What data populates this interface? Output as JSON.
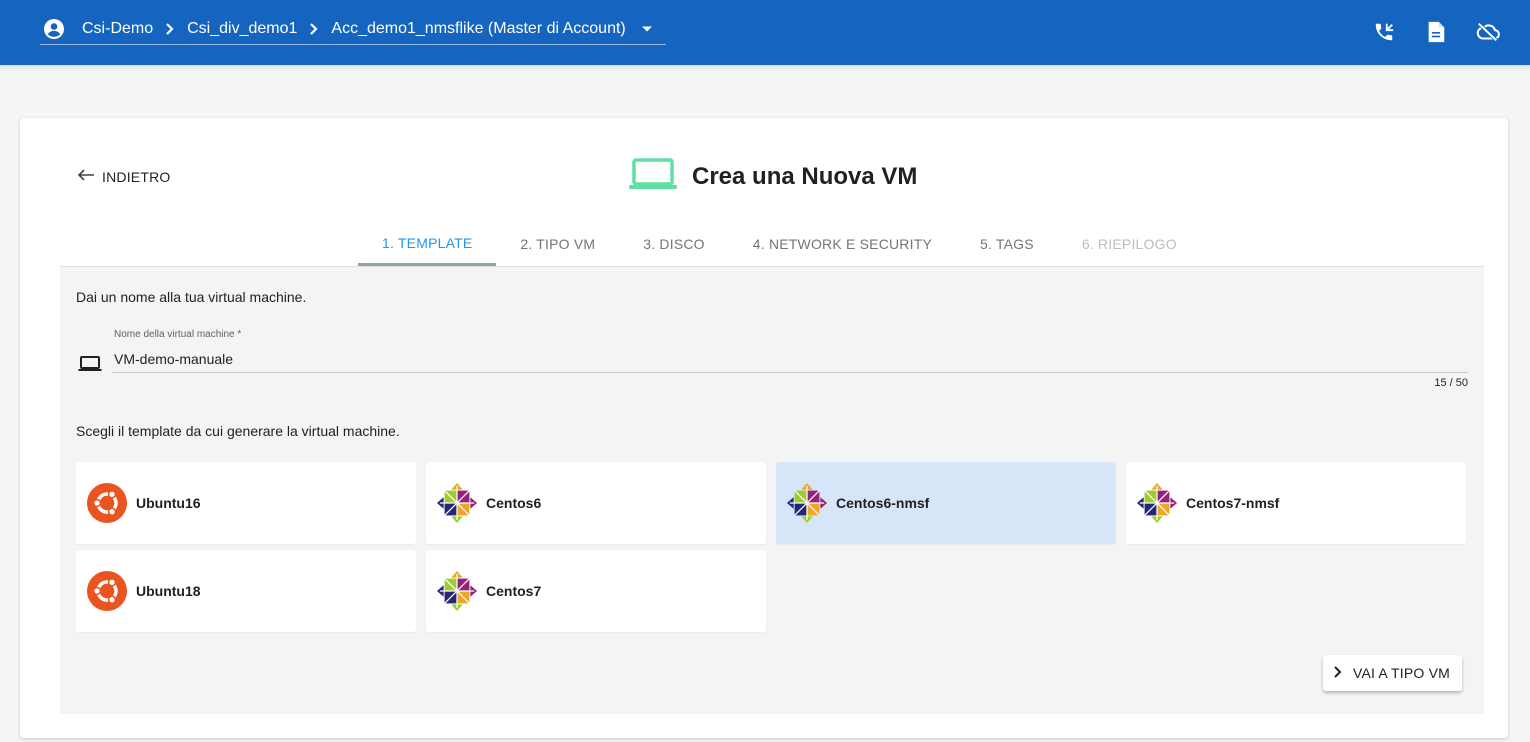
{
  "appbar": {
    "breadcrumb": [
      "Csi-Demo",
      "Csi_div_demo1",
      "Acc_demo1_nmsflike (Master di Account)"
    ],
    "actions": [
      "phone-forward-icon",
      "document-icon",
      "cloud-off-icon"
    ],
    "color": "#1565c0"
  },
  "page": {
    "back_label": "INDIETRO",
    "title": "Crea una Nuova VM",
    "title_icon_color": "#5ee0a4"
  },
  "tabs": [
    {
      "label": "1. TEMPLATE",
      "state": "active"
    },
    {
      "label": "2. TIPO VM",
      "state": "normal"
    },
    {
      "label": "3. DISCO",
      "state": "normal"
    },
    {
      "label": "4. NETWORK E SECURITY",
      "state": "normal"
    },
    {
      "label": "5. TAGS",
      "state": "normal"
    },
    {
      "label": "6. RIEPILOGO",
      "state": "disabled"
    }
  ],
  "form": {
    "intro": "Dai un nome alla tua virtual machine.",
    "name_label": "Nome della virtual machine *",
    "name_value": "VM-demo-manuale",
    "counter": "15 / 50",
    "template_prompt": "Scegli il template da cui generare la virtual machine."
  },
  "templates": [
    {
      "name": "Ubuntu16",
      "os": "ubuntu",
      "selected": false
    },
    {
      "name": "Centos6",
      "os": "centos",
      "selected": false
    },
    {
      "name": "Centos6-nmsf",
      "os": "centos",
      "selected": true
    },
    {
      "name": "Centos7-nmsf",
      "os": "centos",
      "selected": false
    },
    {
      "name": "Ubuntu18",
      "os": "ubuntu",
      "selected": false
    },
    {
      "name": "Centos7",
      "os": "centos",
      "selected": false
    }
  ],
  "next_button": "VAI A TIPO VM"
}
